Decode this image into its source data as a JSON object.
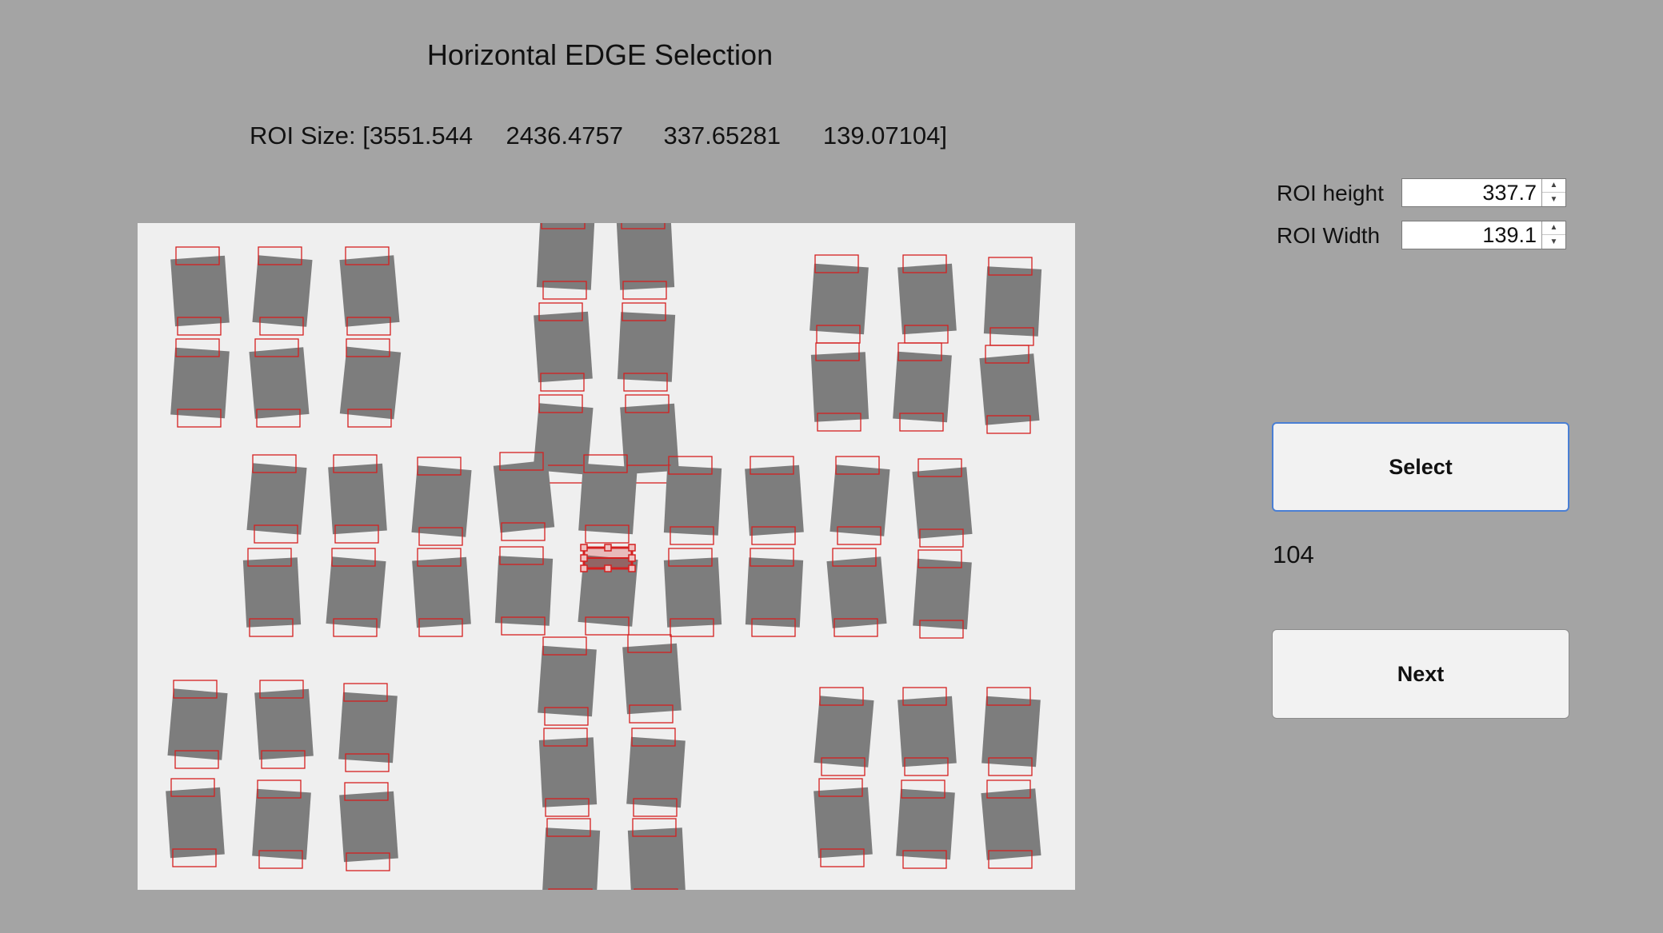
{
  "title": "Horizontal EDGE Selection",
  "roi_size": {
    "label": "ROI Size: [3551.544",
    "values": [
      "2436.4757",
      "337.65281",
      "139.07104]"
    ]
  },
  "fields": {
    "roi_height": {
      "label": "ROI height",
      "value": "337.7"
    },
    "roi_width": {
      "label": "ROI Width",
      "value": "139.1"
    }
  },
  "buttons": {
    "select": "Select",
    "next": "Next"
  },
  "count": "104",
  "colors": {
    "background": "#a4a4a4",
    "image_background": "#efefef",
    "tile": "#7d7d7d",
    "roi_box": "#d42020",
    "focus": "#4a7fd4"
  },
  "icons": {
    "spinner_up": "triangle-up-icon",
    "spinner_down": "triangle-down-icon"
  }
}
